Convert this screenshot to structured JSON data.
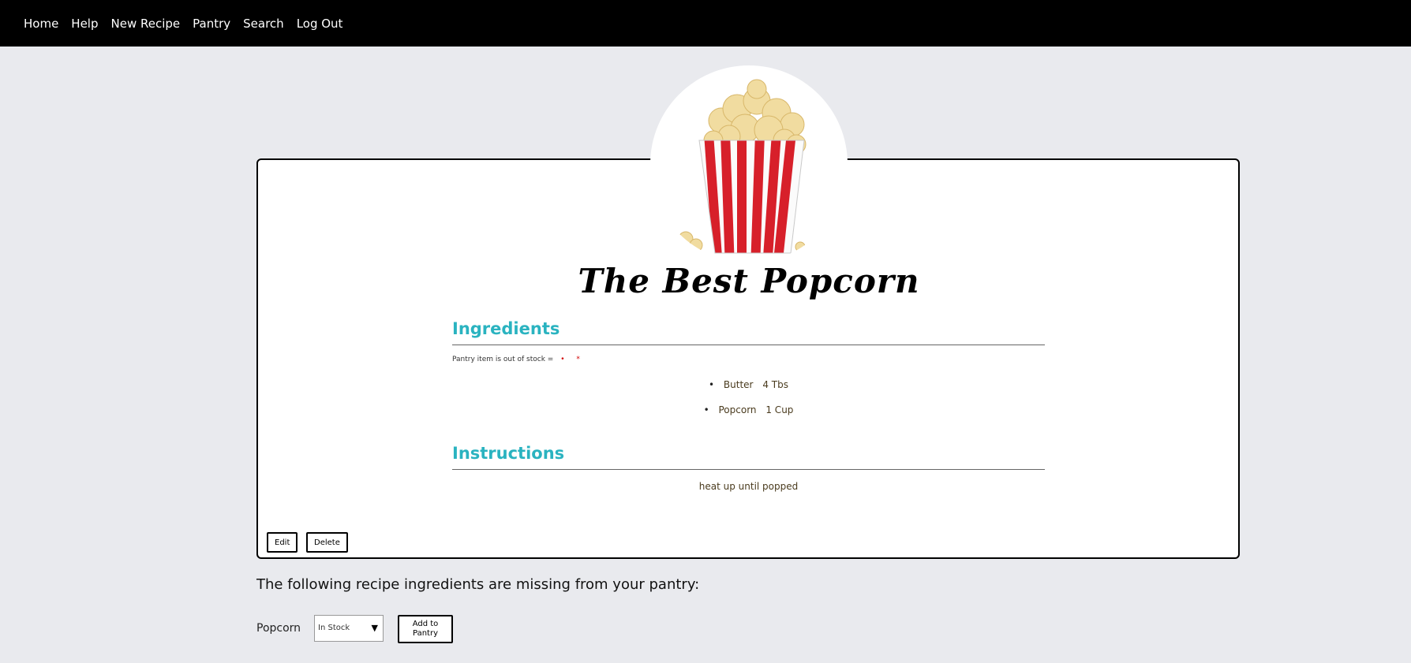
{
  "nav": {
    "items": [
      {
        "label": "Home"
      },
      {
        "label": "Help"
      },
      {
        "label": "New Recipe"
      },
      {
        "label": "Pantry"
      },
      {
        "label": "Search"
      },
      {
        "label": "Log Out"
      }
    ]
  },
  "recipe": {
    "image_icon": "popcorn-box-image",
    "title": "The Best Popcorn",
    "ingredients_heading": "Ingredients",
    "stock_note": "Pantry item is out of stock =",
    "stock_dots": "• *",
    "ingredients": [
      {
        "name": "Butter",
        "qty": "4 Tbs"
      },
      {
        "name": "Popcorn",
        "qty": "1 Cup"
      }
    ],
    "bullet": "•",
    "instructions_heading": "Instructions",
    "instructions_text": "heat up until popped",
    "edit_label": "Edit",
    "delete_label": "Delete"
  },
  "missing": {
    "heading": "The following recipe ingredients are missing from your pantry:",
    "items": [
      {
        "name": "Popcorn",
        "status": "In Stock",
        "add_label": "Add to Pantry"
      }
    ]
  },
  "colors": {
    "nav_bg": "#000000",
    "page_bg": "#e9eaee",
    "heading_accent": "#2ab3c0",
    "out_of_stock_marker": "#d20000"
  }
}
